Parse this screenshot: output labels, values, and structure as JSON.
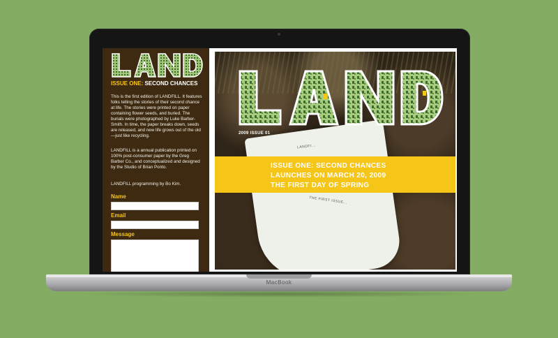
{
  "device": {
    "brand": "MacBook"
  },
  "colors": {
    "background": "#84ad63",
    "panel": "#3d2a10",
    "accent": "#f5c518"
  },
  "sidebar": {
    "logo": "LAND",
    "issue_prefix": "ISSUE ONE:",
    "issue_name": "SECOND CHANCES",
    "paragraph1": "This is the first edition of LANDFILL. It features folks telling the stories of their second chance at life. The stories were printed on paper containing flower seeds, and buried. The burials were photographed by Luke Barber-Smith. In time, the paper breaks down, seeds are released, and new life grows out of the old—just like recycling.",
    "paragraph2": "LANDFILL is a annual publication printed on 100% post-consumer paper by the Greg Barber Co., and conceptualized and designed by the Studio of Brian Ponto.",
    "paragraph3": "LANDFILL programming by Bo Kim.",
    "form": {
      "name_label": "Name",
      "email_label": "Email",
      "message_label": "Message"
    }
  },
  "hero": {
    "logo": "LAND",
    "issue_tag": "2009 ISSUE 01",
    "paper_text1": "LANDFI...",
    "paper_text2": "THE FIRST ISSUE...",
    "banner": [
      "ISSUE ONE: SECOND CHANCES",
      "LAUNCHES ON MARCH 20, 2009",
      "THE FIRST DAY OF SPRING"
    ]
  }
}
